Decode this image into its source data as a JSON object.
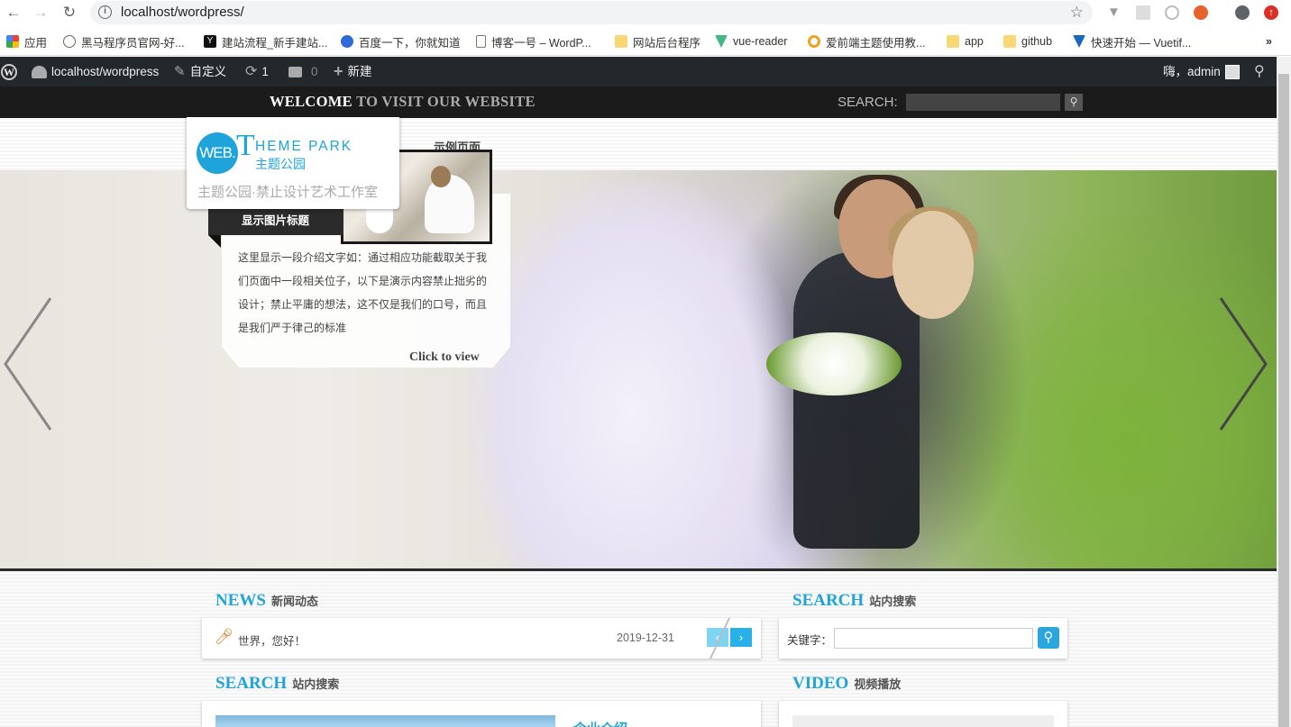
{
  "browser": {
    "url": "localhost/wordpress/",
    "bookmarks": [
      {
        "label": "应用",
        "icon": "apps-grid-icon"
      },
      {
        "label": "黑马程序员官网-好...",
        "icon": "site-icon"
      },
      {
        "label": "建站流程_新手建站...",
        "icon": "y-icon"
      },
      {
        "label": "百度一下，你就知道",
        "icon": "baidu-paw-icon"
      },
      {
        "label": "博客一号 – WordP...",
        "icon": "page-icon"
      },
      {
        "label": "网站后台程序",
        "icon": "folder-icon"
      },
      {
        "label": "vue-reader",
        "icon": "vue-icon"
      },
      {
        "label": "爱前端主题使用教...",
        "icon": "sync-icon"
      },
      {
        "label": "app",
        "icon": "folder-icon"
      },
      {
        "label": "github",
        "icon": "folder-icon"
      },
      {
        "label": "快速开始 — Vuetif...",
        "icon": "vuetify-icon"
      }
    ],
    "overflow": "»"
  },
  "adminbar": {
    "site": "localhost/wordpress",
    "customize": "自定义",
    "updates": "1",
    "comments": "0",
    "new": "新建",
    "greeting": "嗨，admin"
  },
  "header": {
    "welcome_bold": "WELCOME",
    "welcome_rest": " TO VISIT OUR WEBSITE",
    "search_label": "SEARCH:",
    "nav_item": "示例页面"
  },
  "logo": {
    "circle": "WEB.",
    "letter": "T",
    "name": "HEME PARK",
    "cn": "主题公园",
    "tagline": "主题公园·禁止设计艺术工作室"
  },
  "slider": {
    "caption_title": "显示图片标题",
    "caption_text": "这里显示一段介绍文字如：通过相应功能截取关于我们页面中一段相关位子，以下是演示内容禁止拙劣的设计；禁止平庸的想法，这不仅是我们的口号，而且是我们严于律己的标准",
    "link": "Click to view"
  },
  "sections": {
    "news": {
      "title": "NEWS",
      "sub": "新闻动态",
      "item": "世界，您好！",
      "date": "2019-12-31"
    },
    "search": {
      "title": "SEARCH",
      "sub": "站内搜索",
      "keyword_label": "关键字："
    },
    "search2": {
      "title": "SEARCH",
      "sub": "站内搜索",
      "text": "企业介绍"
    },
    "video": {
      "title": "VIDEO",
      "sub": "视频播放"
    }
  }
}
